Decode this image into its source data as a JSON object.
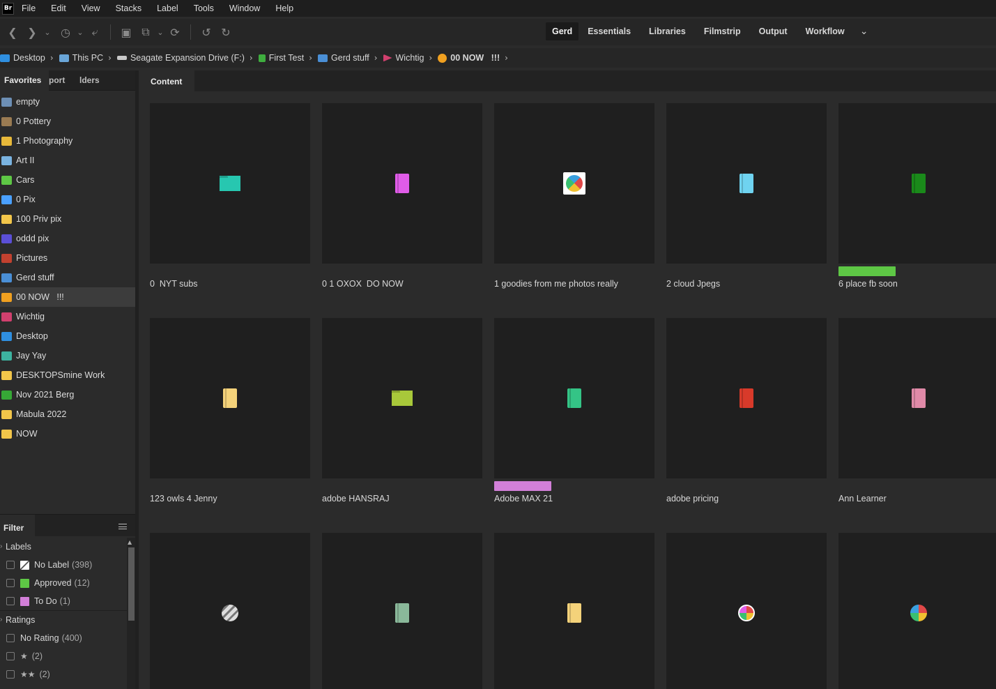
{
  "app": {
    "logo": "Br"
  },
  "menu": [
    "File",
    "Edit",
    "View",
    "Stacks",
    "Label",
    "Tools",
    "Window",
    "Help"
  ],
  "toolbar": {
    "icons": [
      "back-icon",
      "forward-icon",
      "chevron-down-icon",
      "recent-icon",
      "chevron-down-icon",
      "boomerang-icon",
      "camera-download-icon",
      "copy-icon",
      "chevron-down-icon",
      "refine-icon",
      "rotate-left-icon",
      "rotate-right-icon"
    ]
  },
  "workspaces": {
    "tabs": [
      "Gerd",
      "Essentials",
      "Libraries",
      "Filmstrip",
      "Output",
      "Workflow"
    ],
    "active": "Gerd"
  },
  "path": [
    {
      "label": "Desktop",
      "icon_color": "#2f8fe0"
    },
    {
      "label": "This PC",
      "icon_color": "#6aa6d8"
    },
    {
      "label": "Seagate Expansion Drive (F:)",
      "icon_color": "#c8c8c8"
    },
    {
      "label": "First Test",
      "icon_color": "#3fae3f"
    },
    {
      "label": "Gerd stuff",
      "icon_color": "#4a8fd6"
    },
    {
      "label": "Wichtig",
      "icon_color": "#d1406e"
    },
    {
      "label": "00 NOW   !!!",
      "icon_color": "#f0a020"
    }
  ],
  "left_panel": {
    "tabs": [
      "Favorites",
      "port",
      "lders"
    ],
    "favorites": [
      {
        "label": "empty",
        "color": "#6d8fb5"
      },
      {
        "label": "0 Pottery",
        "color": "#9a7b52"
      },
      {
        "label": "1 Photography",
        "color": "#e8b93a"
      },
      {
        "label": "Art II",
        "color": "#7ab3e0"
      },
      {
        "label": "Cars",
        "color": "#5ec745"
      },
      {
        "label": "0 Pix",
        "color": "#4aa0ff"
      },
      {
        "label": "100 Priv pix",
        "color": "#f2c64a"
      },
      {
        "label": "oddd pix",
        "color": "#5b4fd6"
      },
      {
        "label": "Pictures",
        "color": "#c2412f"
      },
      {
        "label": "Gerd stuff",
        "color": "#4a8fd6"
      },
      {
        "label": "00 NOW   !!!",
        "color": "#f0a020"
      },
      {
        "label": "Wichtig",
        "color": "#d1406e"
      },
      {
        "label": "Desktop",
        "color": "#2f8fe0"
      },
      {
        "label": "Jay Yay",
        "color": "#3db3a0"
      },
      {
        "label": "DESKTOPSmine Work",
        "color": "#f2c64a"
      },
      {
        "label": "Nov 2021 Berg",
        "color": "#36a836"
      },
      {
        "label": "Mabula 2022",
        "color": "#f2c64a"
      },
      {
        "label": "NOW",
        "color": "#f2c64a"
      }
    ],
    "selected": "00 NOW   !!!"
  },
  "filter": {
    "title": "Filter",
    "labels_title": "Labels",
    "labels": [
      {
        "name": "No Label",
        "count": "(398)",
        "color": "none"
      },
      {
        "name": "Approved",
        "count": "(12)",
        "color": "#5ec745"
      },
      {
        "name": "To Do",
        "count": "(1)",
        "color": "#d27fd8"
      }
    ],
    "ratings_title": "Ratings",
    "ratings": [
      {
        "name": "No Rating",
        "count": "(400)"
      },
      {
        "name": "★",
        "count": "(2)"
      },
      {
        "name": "★★",
        "count": "(2)"
      }
    ]
  },
  "content": {
    "tab": "Content",
    "items": [
      {
        "name": "0  NYT subs",
        "icon": "folder-icon",
        "color": "#27c7b0",
        "label_color": ""
      },
      {
        "name": "0 1 OXOX  DO NOW",
        "icon": "book-icon",
        "color": "#e05ce8",
        "label_color": ""
      },
      {
        "name": "1 goodies from me photos really",
        "icon": "badge-icon",
        "color": "#e04848",
        "label_color": ""
      },
      {
        "name": "2 cloud Jpegs",
        "icon": "book-icon",
        "color": "#6fd3f0",
        "label_color": ""
      },
      {
        "name": "6 place fb soon",
        "icon": "book-icon",
        "color": "#1a8a1a",
        "label_color": "#5ec745"
      },
      {
        "name": "123 owls 4 Jenny",
        "icon": "book-icon",
        "color": "#f4d27a",
        "label_color": ""
      },
      {
        "name": "adobe HANSRAJ",
        "icon": "folder-icon",
        "color": "#a8c83a",
        "label_color": ""
      },
      {
        "name": "Adobe MAX 21",
        "icon": "book-icon",
        "color": "#34c486",
        "label_color": "#d27fd8"
      },
      {
        "name": "adobe pricing",
        "icon": "book-icon",
        "color": "#d83a2a",
        "label_color": ""
      },
      {
        "name": "Ann Learner",
        "icon": "book-icon",
        "color": "#e08aa8",
        "label_color": ""
      },
      {
        "name": "",
        "icon": "badge-icon",
        "color": "#9a9a9a",
        "label_color": ""
      },
      {
        "name": "",
        "icon": "book-icon",
        "color": "#8ab89a",
        "label_color": ""
      },
      {
        "name": "",
        "icon": "book-icon",
        "color": "#f4d27a",
        "label_color": ""
      },
      {
        "name": "",
        "icon": "badge-icon",
        "color": "#e05ce8",
        "label_color": ""
      },
      {
        "name": "",
        "icon": "badge-icon",
        "color": "#3aa0e0",
        "label_color": ""
      }
    ]
  }
}
